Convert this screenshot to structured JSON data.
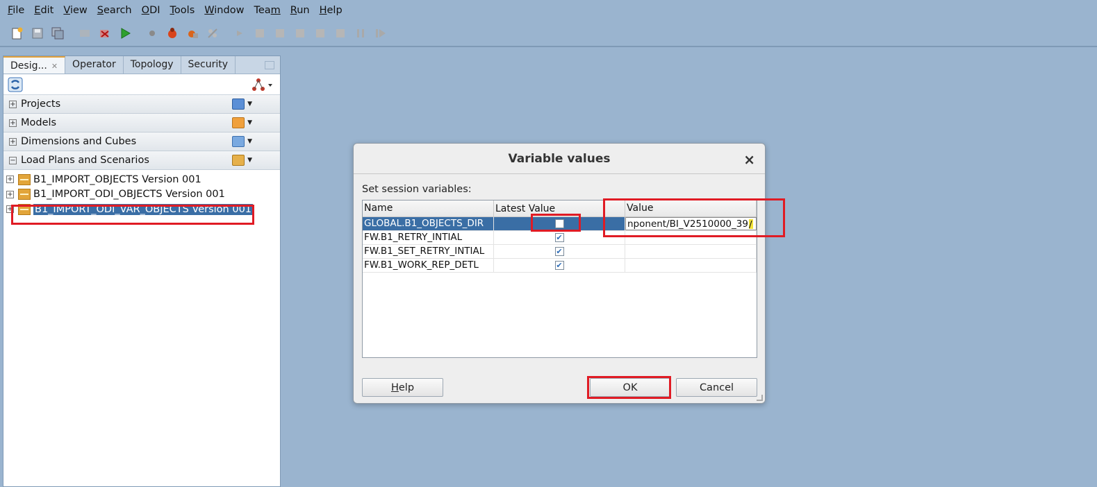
{
  "menu": [
    {
      "label": "File",
      "mnemonic": "F",
      "rest": "ile"
    },
    {
      "label": "Edit",
      "mnemonic": "E",
      "rest": "dit"
    },
    {
      "label": "View",
      "mnemonic": "V",
      "rest": "iew"
    },
    {
      "label": "Search",
      "mnemonic": "S",
      "rest": "earch"
    },
    {
      "label": "ODI",
      "mnemonic": "O",
      "rest": "DI"
    },
    {
      "label": "Tools",
      "mnemonic": "T",
      "rest": "ools"
    },
    {
      "label": "Window",
      "mnemonic": "W",
      "rest": "indow"
    },
    {
      "label": "Team",
      "mnemonic": "m",
      "rest": "Tea"
    },
    {
      "label": "Run",
      "mnemonic": "R",
      "rest": "un"
    },
    {
      "label": "Help",
      "mnemonic": "H",
      "rest": "elp"
    }
  ],
  "menu_flat": {
    "file_pre": "",
    "file_m": "F",
    "file_post": "ile",
    "edit_pre": "",
    "edit_m": "E",
    "edit_post": "dit",
    "view_pre": "",
    "view_m": "V",
    "view_post": "iew",
    "search_pre": "",
    "search_m": "S",
    "search_post": "earch",
    "odi_pre": "",
    "odi_m": "O",
    "odi_post": "DI",
    "tools_pre": "",
    "tools_m": "T",
    "tools_post": "ools",
    "window_pre": "",
    "window_m": "W",
    "window_post": "indow",
    "team_pre": "Tea",
    "team_m": "m",
    "team_post": "",
    "run_pre": "",
    "run_m": "R",
    "run_post": "un",
    "help_pre": "",
    "help_m": "H",
    "help_post": "elp"
  },
  "toolbar": {
    "icons": [
      "new-icon",
      "save-icon",
      "save-all-icon",
      "cut-icon",
      "delete-icon",
      "run-icon",
      "breakpoint-icon",
      "debug-icon",
      "debug-settings-icon",
      "debug-clear-icon",
      "step-icon",
      "step-into-icon",
      "step-over-icon",
      "step-out-icon",
      "step-back-icon",
      "pause-icon",
      "resume-icon"
    ]
  },
  "left_panel": {
    "tabs": {
      "designer": "Desig...",
      "operator": "Operator",
      "topology": "Topology",
      "security": "Security"
    },
    "accordions": {
      "projects": "Projects",
      "models": "Models",
      "dimensions": "Dimensions and Cubes",
      "loadplans": "Load Plans and Scenarios"
    },
    "tree": {
      "item1": "B1_IMPORT_OBJECTS Version 001",
      "item2": "B1_IMPORT_ODI_OBJECTS Version 001",
      "item3": "B1_IMPORT_ODI_VAR_OBJECTS Version 001"
    }
  },
  "dialog": {
    "title": "Variable values",
    "close": "×",
    "subtitle": "Set session variables:",
    "columns": {
      "name": "Name",
      "latest": "Latest Value",
      "value": "Value"
    },
    "rows": [
      {
        "name": "GLOBAL.B1_OBJECTS_DIR",
        "latest": false,
        "value": "nponent/BI_V2510000_39/"
      },
      {
        "name": "FW.B1_RETRY_INTIAL",
        "latest": true,
        "value": ""
      },
      {
        "name": "FW.B1_SET_RETRY_INTIAL",
        "latest": true,
        "value": ""
      },
      {
        "name": "FW.B1_WORK_REP_DETL",
        "latest": true,
        "value": ""
      }
    ],
    "value_main": "nponent/BI_V2510000_39",
    "value_tail": "/",
    "buttons": {
      "help_m": "H",
      "help_rest": "elp",
      "ok": "OK",
      "cancel": "Cancel"
    }
  },
  "colors": {
    "background": "#9ab4cf",
    "selection": "#3a6ea5",
    "highlight_red": "#e01b24"
  }
}
